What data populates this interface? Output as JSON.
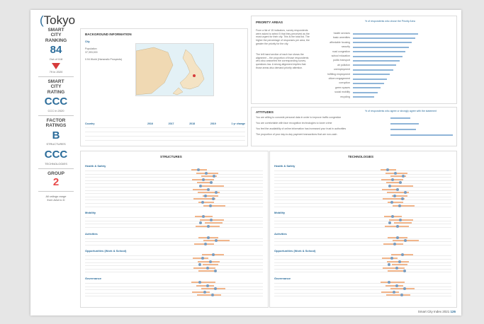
{
  "title": "Tokyo",
  "sidebar": {
    "smart_city_ranking_label": "SMART\nCITY\nRANKING",
    "ranking_value": "84",
    "ranking_out_of": "Out of 118",
    "ranking_prev": "79 in 2020",
    "smart_city_rating_label": "SMART\nCITY\nRATING",
    "rating_value": "CCC",
    "rating_prev": "CCC in 2020",
    "factor_ratings_label": "FACTOR\nRATINGS",
    "structures_rating": "B",
    "structures_label": "STRUCTURES",
    "technologies_rating": "CCC",
    "technologies_label": "TECHNOLOGIES",
    "group_label": "GROUP",
    "group_value": "2",
    "ratings_footnote": "All ratings range\nfrom AAA to D"
  },
  "background": {
    "heading": "BACKGROUND INFORMATION",
    "city_label": "City",
    "population_label": "Population",
    "population_value": "37,393,000",
    "hdi_label": "0.94 World (Hanseatic Prospects)",
    "table_header_country": "Country",
    "years": [
      "2016",
      "2017",
      "2018",
      "2019",
      "1 yr change"
    ]
  },
  "priority": {
    "heading": "PRIORITY AREAS",
    "chart_caption": "% of respondents who chose the Priority Area",
    "intro_1": "From a list of 15 indicators, survey respondents were asked to select 5 that they perceived as the most urgent for their city. This is the total list. The higher the percentage of responses per area, the greater the priority for the city.",
    "intro_2": "The left hand section of each bar shows the alignment – the proportion of those respondents who also answered the corresponding survey questions low. A strong alignment implies that those areas also demand priority attention.",
    "areas": [
      "health services",
      "basic amenities",
      "affordable housing",
      "security",
      "road congestion",
      "school education",
      "public transport",
      "air pollution",
      "unemployment",
      "fulfilling employment",
      "citizen engagement",
      "corruption",
      "green spaces",
      "social mobility",
      "recycling"
    ]
  },
  "attitudes": {
    "heading": "ATTITUDES",
    "chart_caption": "% of respondents who agree or strongly agree with the statement",
    "statements": [
      "You are willing to concede personal data in order to improve traffic congestion",
      "You are comfortable with face recognition technologies to lower crime",
      "You feel the availability of online information has increased your trust in authorities",
      "The proportion of your day-to-day payment transactions that are non-cash"
    ]
  },
  "structures": {
    "heading": "STRUCTURES",
    "sections": [
      "Health & Safety",
      "Mobility",
      "Activities",
      "Opportunities (Work & School)",
      "Governance"
    ]
  },
  "technologies": {
    "heading": "TECHNOLOGIES",
    "sections": [
      "Health & Safety",
      "Mobility",
      "Activities",
      "Opportunities (Work & School)",
      "Governance"
    ]
  },
  "footer": {
    "text": "Smart City Index 2021",
    "page": "126"
  },
  "colors": {
    "accent": "#2b6c9a",
    "red": "#d63b3b",
    "bar_blue": "#8fb5d8",
    "bar_orange": "#f2b58a"
  }
}
